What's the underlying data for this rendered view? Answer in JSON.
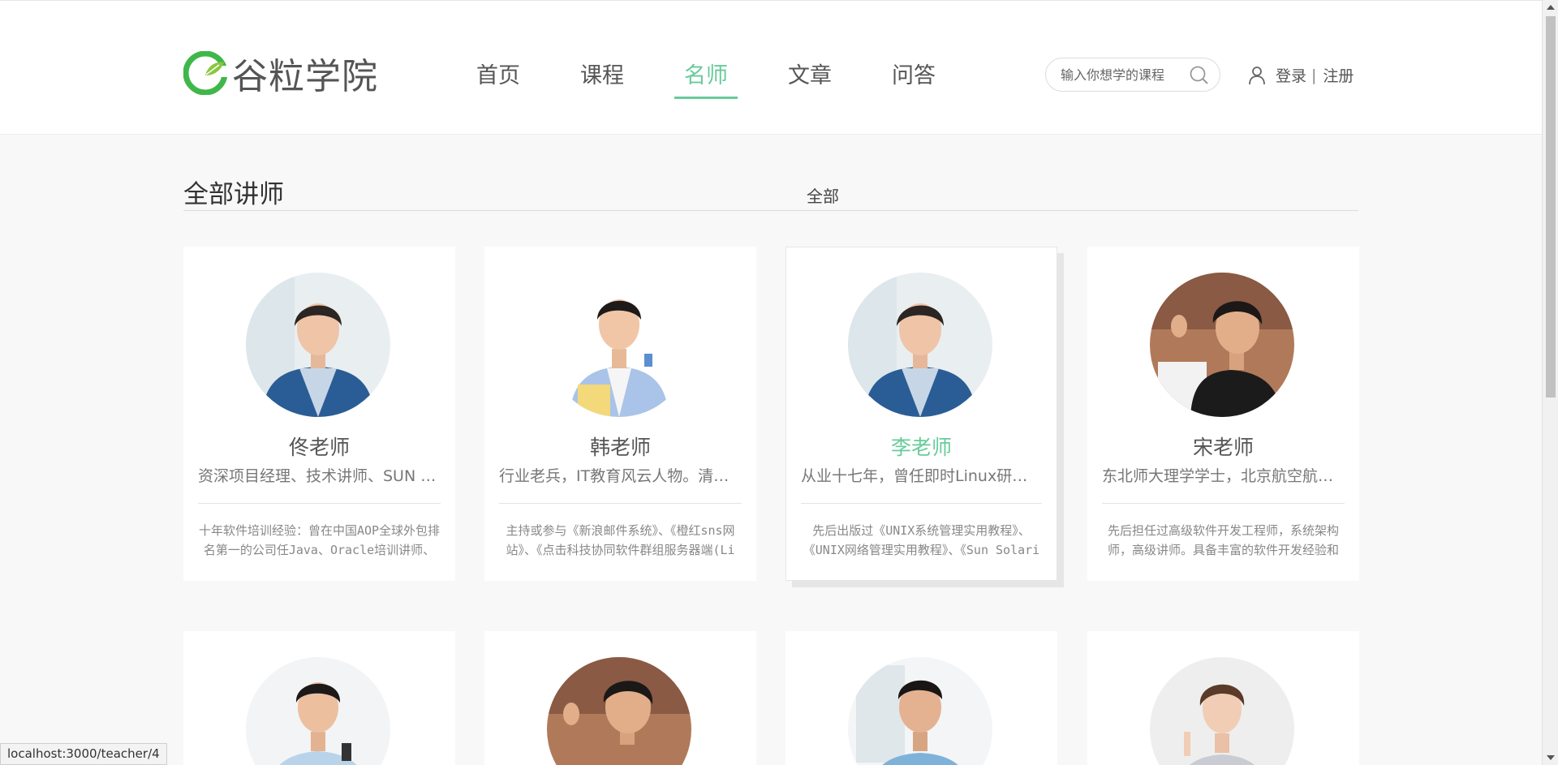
{
  "header": {
    "logo_text": "谷粒学院",
    "brand_color": "#68cb9b",
    "nav": [
      {
        "label": "首页",
        "active": false
      },
      {
        "label": "课程",
        "active": false
      },
      {
        "label": "名师",
        "active": true
      },
      {
        "label": "文章",
        "active": false
      },
      {
        "label": "问答",
        "active": false
      }
    ],
    "search_placeholder": "输入你想学的课程",
    "login_label": "登录",
    "separator": "|",
    "register_label": "注册"
  },
  "main": {
    "title": "全部讲师",
    "filter_all": "全部"
  },
  "teachers": [
    {
      "name": "佟老师",
      "intro": "资深项目经理、技术讲师、SUN SCJP",
      "desc": "十年软件培训经验：曾在中国AOP全球外包排名第一的公司任Java、Oracle培训讲师、员"
    },
    {
      "name": "韩老师",
      "intro": "行业老兵，IT教育风云人物。清华毕业",
      "desc": "主持或参与《新浪邮件系统》、《橙红sns网站》、《点击科技协同软件群组服务器端(Li"
    },
    {
      "name": "李老师",
      "intro": "从业十七年，曾任即时Linux研究院院长",
      "desc": "先后出版过《UNIX系统管理实用教程》、《UNIX网络管理实用教程》、《Sun Solari"
    },
    {
      "name": "宋老师",
      "intro": "东北师大理学学士，北京航空航天大学硕士",
      "desc": "先后担任过高级软件开发工程师，系统架构师，高级讲师。具备丰富的软件开发经验和"
    }
  ],
  "status_url": "localhost:3000/teacher/4",
  "icons": {
    "logo": "leaf-logo-icon",
    "search": "search-icon",
    "user": "user-icon"
  }
}
